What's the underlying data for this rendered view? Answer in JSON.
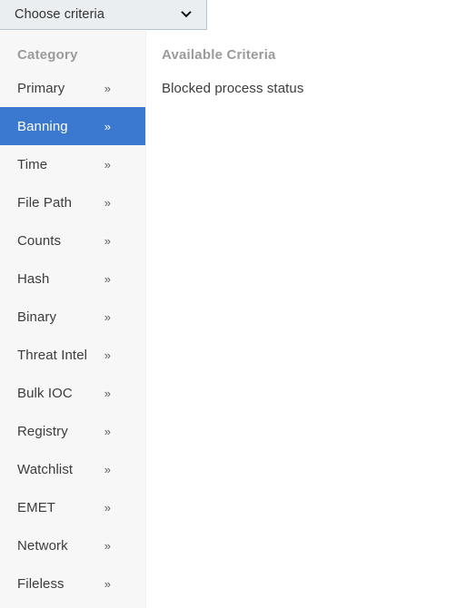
{
  "dropdown": {
    "label": "Choose criteria",
    "icon": "chevron-down-icon"
  },
  "sidebar": {
    "header": "Category",
    "arrow_glyph": "»",
    "items": [
      {
        "label": "Primary",
        "selected": false
      },
      {
        "label": "Banning",
        "selected": true
      },
      {
        "label": "Time",
        "selected": false
      },
      {
        "label": "File Path",
        "selected": false
      },
      {
        "label": "Counts",
        "selected": false
      },
      {
        "label": "Hash",
        "selected": false
      },
      {
        "label": "Binary",
        "selected": false
      },
      {
        "label": "Threat Intel",
        "selected": false
      },
      {
        "label": "Bulk IOC",
        "selected": false
      },
      {
        "label": "Registry",
        "selected": false
      },
      {
        "label": "Watchlist",
        "selected": false
      },
      {
        "label": "EMET",
        "selected": false
      },
      {
        "label": "Network",
        "selected": false
      },
      {
        "label": "Fileless",
        "selected": false
      }
    ]
  },
  "criteria": {
    "header": "Available Criteria",
    "items": [
      {
        "label": "Blocked process status"
      }
    ]
  },
  "colors": {
    "selection_blue": "#3b78cf",
    "sidebar_bg": "#f7f7f8",
    "dropdown_bg": "#eaeef1",
    "header_gray": "#9b9b9b",
    "text_dark": "#3c3c3c"
  }
}
